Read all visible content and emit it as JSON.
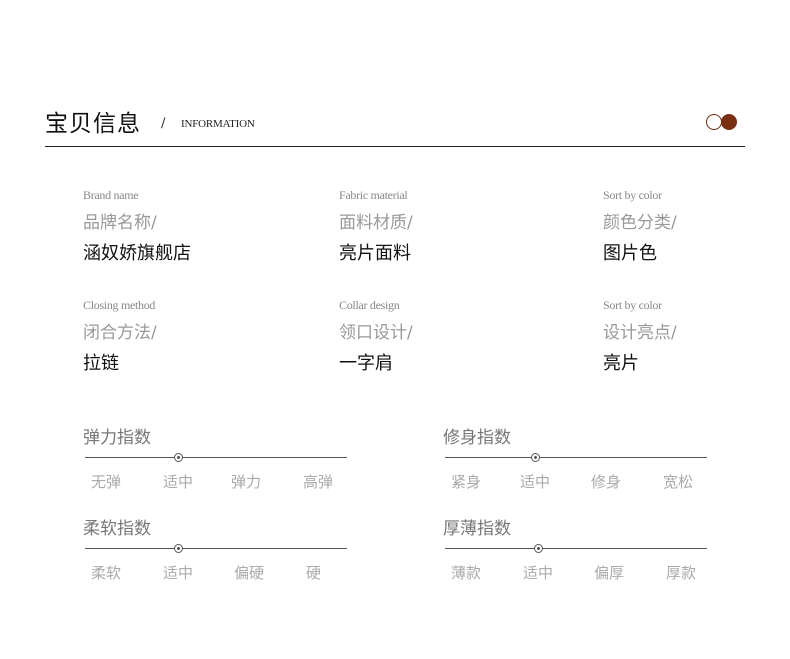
{
  "header": {
    "title": "宝贝信息",
    "slash": "/",
    "subtitle": "INFORMATION",
    "dot_colors": [
      "#ffffff",
      "#7a2e12"
    ]
  },
  "info": [
    {
      "en": "Brand name",
      "cn": "品牌名称/",
      "value": "涵奴娇旗舰店"
    },
    {
      "en": "Fabric material",
      "cn": "面料材质/",
      "value": "亮片面料"
    },
    {
      "en": "Sort by color",
      "cn": "颜色分类/",
      "value": "图片色"
    },
    {
      "en": "Closing method",
      "cn": "闭合方法/",
      "value": "拉链"
    },
    {
      "en": "Collar design",
      "cn": "领口设计/",
      "value": "一字肩"
    },
    {
      "en": "Sort by color",
      "cn": "设计亮点/",
      "value": "亮片"
    }
  ],
  "scales": [
    {
      "title": "弹力指数",
      "labels": [
        "无弹",
        "适中",
        "弹力",
        "高弹"
      ],
      "selected_index": 1
    },
    {
      "title": "修身指数",
      "labels": [
        "紧身",
        "适中",
        "修身",
        "宽松"
      ],
      "selected_index": 1
    },
    {
      "title": "柔软指数",
      "labels": [
        "柔软",
        "适中",
        "偏硬",
        "硬"
      ],
      "selected_index": 1
    },
    {
      "title": "厚薄指数",
      "labels": [
        "薄款",
        "适中",
        "偏厚",
        "厚款"
      ],
      "selected_index": 1
    }
  ]
}
